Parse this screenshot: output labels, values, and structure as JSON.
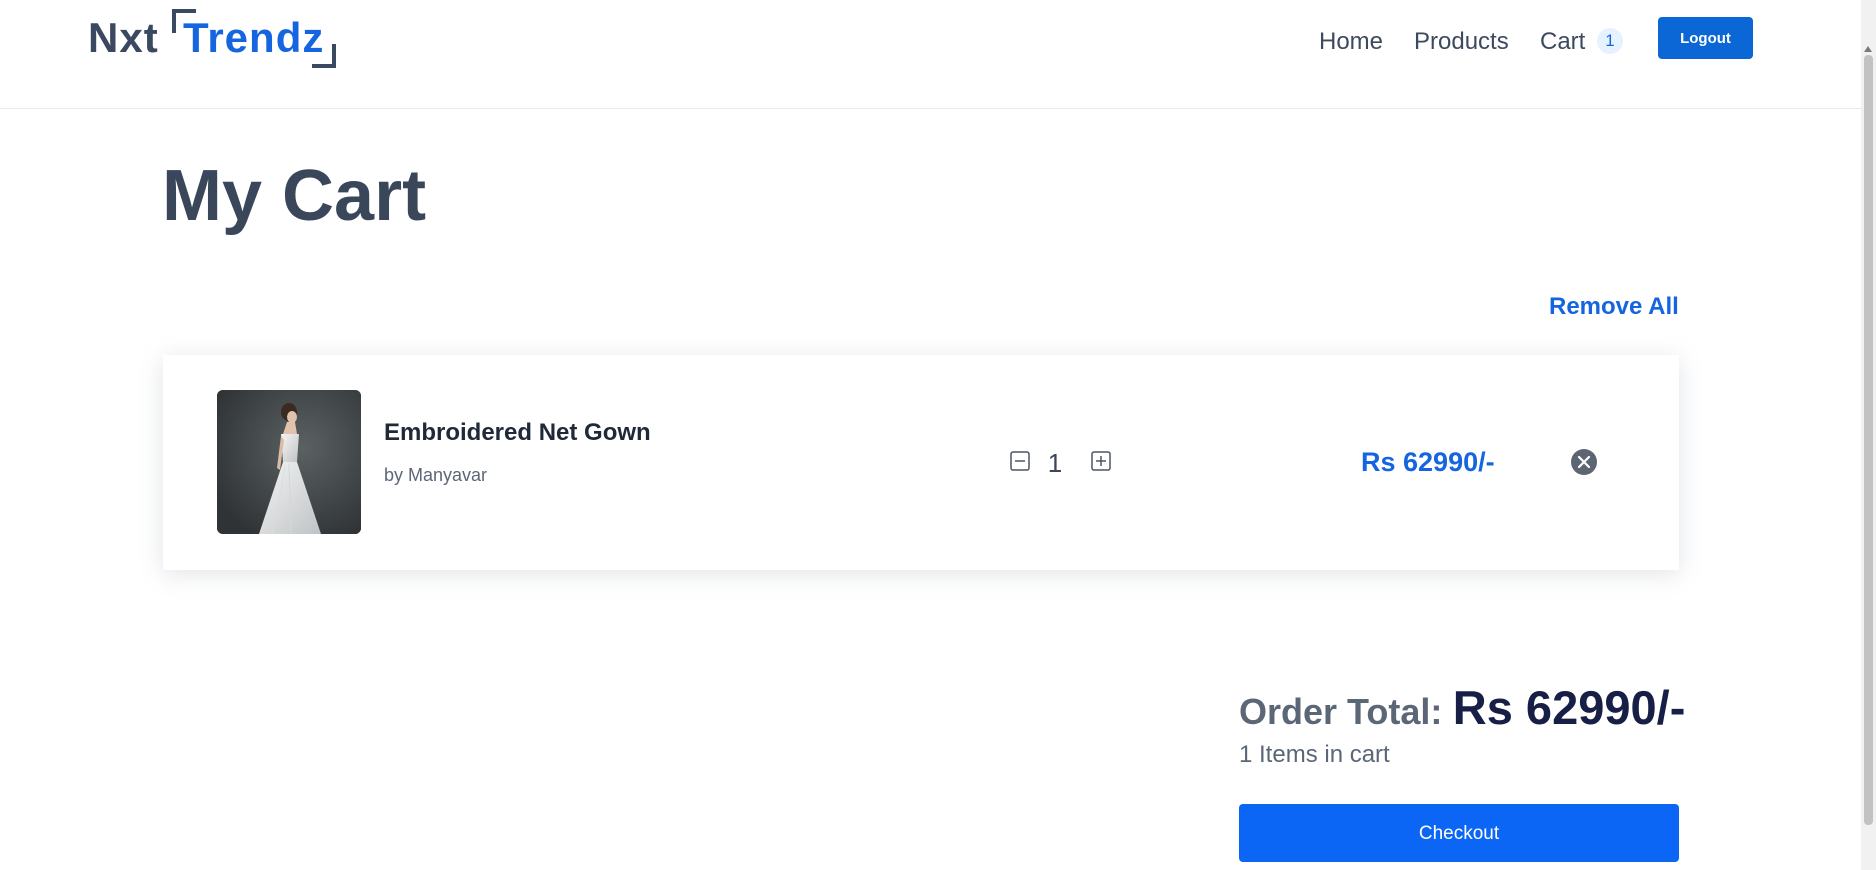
{
  "header": {
    "logo": {
      "part1": "Nxt",
      "part2": "Trendz"
    },
    "nav": {
      "home": "Home",
      "products": "Products",
      "cart": "Cart",
      "cart_count": "1"
    },
    "logout_label": "Logout"
  },
  "page": {
    "title": "My Cart",
    "remove_all_label": "Remove All"
  },
  "cart_items": [
    {
      "title": "Embroidered Net Gown",
      "brand": "by Manyavar",
      "quantity": "1",
      "price": "Rs 62990/-",
      "image_icon": "gown-product-image"
    }
  ],
  "summary": {
    "order_total_label": "Order Total:",
    "order_total_value": "Rs 62990/-",
    "items_count_text": "1 Items in cart",
    "checkout_label": "Checkout"
  },
  "colors": {
    "accent": "#1565e0",
    "checkout": "#0b66f6",
    "heading": "#3a4659",
    "total_value": "#171f46"
  }
}
